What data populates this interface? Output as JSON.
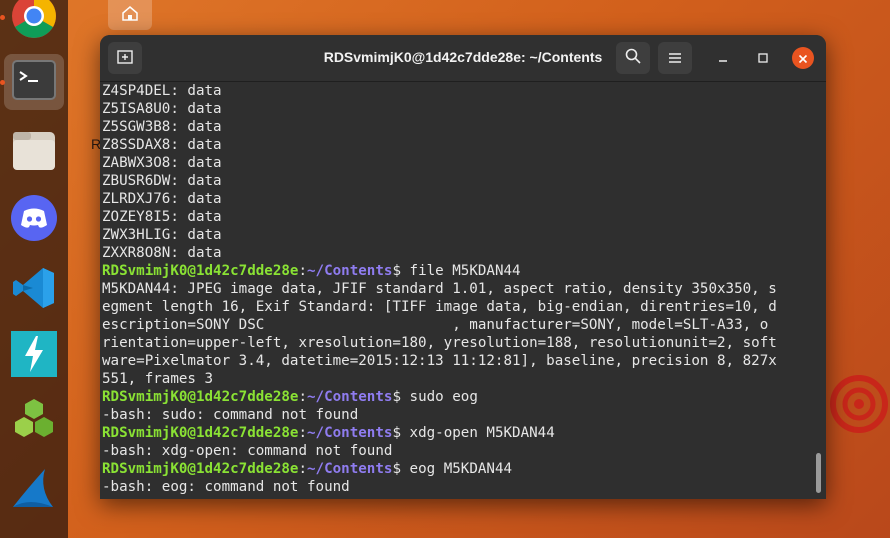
{
  "desktop": {
    "stray_letter": "R"
  },
  "dock": {
    "items": [
      {
        "name": "Google Chrome"
      },
      {
        "name": "Terminal"
      },
      {
        "name": "Files"
      },
      {
        "name": "Discord"
      },
      {
        "name": "Visual Studio Code"
      },
      {
        "name": "Lightning app"
      },
      {
        "name": "Hex app"
      },
      {
        "name": "Wireshark"
      }
    ]
  },
  "window": {
    "title": "RDSvmimjK0@1d42c7dde28e: ~/Contents",
    "prompt_user": "RDSvmimjK0@1d42c7dde28e",
    "prompt_path": "~/Contents"
  },
  "terminal": {
    "output_top": [
      "Z4SP4DEL: data",
      "Z5ISA8U0: data",
      "Z5SGW3B8: data",
      "Z8SSDAX8: data",
      "ZABWX3O8: data",
      "ZBUSR6DW: data",
      "ZLRDXJ76: data",
      "ZOZEY8I5: data",
      "ZWX3HLIG: data",
      "ZXXR8O8N: data"
    ],
    "cmd1": "file M5KDAN44",
    "file_output": [
      "M5KDAN44: JPEG image data, JFIF standard 1.01, aspect ratio, density 350x350, s",
      "egment length 16, Exif Standard: [TIFF image data, big-endian, direntries=10, d",
      "escription=SONY DSC                      , manufacturer=SONY, model=SLT-A33, o",
      "rientation=upper-left, xresolution=180, yresolution=188, resolutionunit=2, soft",
      "ware=Pixelmator 3.4, datetime=2015:12:13 11:12:81], baseline, precision 8, 827x",
      "551, frames 3"
    ],
    "cmd2": "sudo eog",
    "out2": "-bash: sudo: command not found",
    "cmd3": "xdg-open M5KDAN44",
    "out3": "-bash: xdg-open: command not found",
    "cmd4": "eog M5KDAN44",
    "out4": "-bash: eog: command not found"
  }
}
